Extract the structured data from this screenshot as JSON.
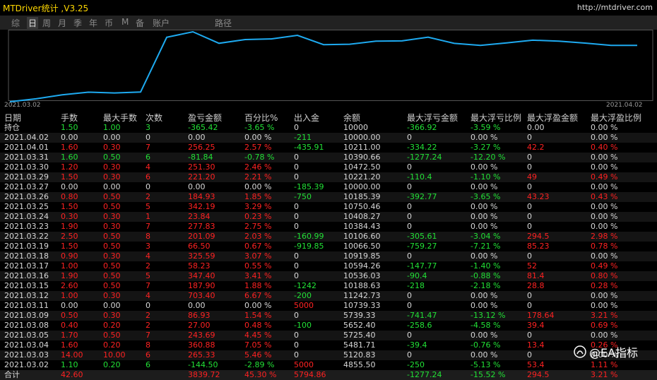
{
  "app": {
    "title": "MTDriver统计 ,V3.25",
    "url": "http://mtdriver.com"
  },
  "tabs": [
    {
      "label": "综",
      "active": false
    },
    {
      "label": "日",
      "active": true
    },
    {
      "label": "周",
      "active": false
    },
    {
      "label": "月",
      "active": false
    },
    {
      "label": "季",
      "active": false
    },
    {
      "label": "年",
      "active": false
    },
    {
      "label": "币",
      "active": false
    },
    {
      "label": "M",
      "active": false
    },
    {
      "label": "备",
      "active": false
    },
    {
      "label": "账户",
      "active": false
    },
    {
      "label": "路径",
      "active": false
    }
  ],
  "chart": {
    "start_label": "2021.03.02",
    "end_label": "2021.04.02",
    "line_color": "#1eaaf0",
    "series": [
      4855.5,
      5120.83,
      5481.71,
      5725.4,
      5652.4,
      5739.33,
      10739.33,
      11242.73,
      10188.63,
      10536.03,
      10594.26,
      10919.85,
      10066.5,
      10106.6,
      10384.43,
      10408.27,
      10750.46,
      10185.39,
      10000.0,
      10221.2,
      10472.5,
      10390.66,
      10211.0,
      10000.0,
      10000.0
    ]
  },
  "colors": {
    "green": "#22e036",
    "red": "#ff2222",
    "white": "#d8d8d8"
  },
  "columns": [
    "日期",
    "手数",
    "最大手数",
    "次数",
    "盈亏金额",
    "百分比%",
    "出入金",
    "余额",
    "最大浮亏金额",
    "最大浮亏比例",
    "最大浮盈金额",
    "最大浮盈比例"
  ],
  "rows": [
    {
      "date": "持仓",
      "lots": "1.50",
      "maxlots": "1.00",
      "count": "3",
      "pnl": "-365.42",
      "pct": "-3.65 %",
      "dep": "0",
      "bal": "10000",
      "mfl": "-366.92",
      "mflp": "-3.59 %",
      "mfp": "0.00",
      "mfpp": "0.00 %",
      "color": "green"
    },
    {
      "date": "2021.04.02",
      "lots": "0.00",
      "maxlots": "0.00",
      "count": "0",
      "pnl": "0.00",
      "pct": "0.00 %",
      "dep": "-211",
      "bal": "10000.00",
      "mfl": "0",
      "mflp": "0.00 %",
      "mfp": "0",
      "mfpp": "0.00 %",
      "color": "white"
    },
    {
      "date": "2021.04.01",
      "lots": "1.60",
      "maxlots": "0.30",
      "count": "7",
      "pnl": "256.25",
      "pct": "2.57 %",
      "dep": "-435.91",
      "bal": "10211.00",
      "mfl": "-334.22",
      "mflp": "-3.27 %",
      "mfp": "42.2",
      "mfpp": "0.40 %",
      "color": "red"
    },
    {
      "date": "2021.03.31",
      "lots": "1.60",
      "maxlots": "0.50",
      "count": "6",
      "pnl": "-81.84",
      "pct": "-0.78 %",
      "dep": "0",
      "bal": "10390.66",
      "mfl": "-1277.24",
      "mflp": "-12.20 %",
      "mfp": "0",
      "mfpp": "0.00 %",
      "color": "green"
    },
    {
      "date": "2021.03.30",
      "lots": "1.20",
      "maxlots": "0.30",
      "count": "4",
      "pnl": "251.30",
      "pct": "2.46 %",
      "dep": "0",
      "bal": "10472.50",
      "mfl": "0",
      "mflp": "0.00 %",
      "mfp": "0",
      "mfpp": "0.00 %",
      "color": "red"
    },
    {
      "date": "2021.03.29",
      "lots": "1.50",
      "maxlots": "0.30",
      "count": "6",
      "pnl": "221.20",
      "pct": "2.21 %",
      "dep": "0",
      "bal": "10221.20",
      "mfl": "-110.4",
      "mflp": "-1.10 %",
      "mfp": "49",
      "mfpp": "0.49 %",
      "color": "red"
    },
    {
      "date": "2021.03.27",
      "lots": "0.00",
      "maxlots": "0.00",
      "count": "0",
      "pnl": "0.00",
      "pct": "0.00 %",
      "dep": "-185.39",
      "bal": "10000.00",
      "mfl": "0",
      "mflp": "0.00 %",
      "mfp": "0",
      "mfpp": "0.00 %",
      "color": "white"
    },
    {
      "date": "2021.03.26",
      "lots": "0.80",
      "maxlots": "0.50",
      "count": "2",
      "pnl": "184.93",
      "pct": "1.85 %",
      "dep": "-750",
      "bal": "10185.39",
      "mfl": "-392.77",
      "mflp": "-3.65 %",
      "mfp": "43.23",
      "mfpp": "0.43 %",
      "color": "red"
    },
    {
      "date": "2021.03.25",
      "lots": "1.50",
      "maxlots": "0.50",
      "count": "5",
      "pnl": "342.19",
      "pct": "3.29 %",
      "dep": "0",
      "bal": "10750.46",
      "mfl": "0",
      "mflp": "0.00 %",
      "mfp": "0",
      "mfpp": "0.00 %",
      "color": "red"
    },
    {
      "date": "2021.03.24",
      "lots": "0.30",
      "maxlots": "0.30",
      "count": "1",
      "pnl": "23.84",
      "pct": "0.23 %",
      "dep": "0",
      "bal": "10408.27",
      "mfl": "0",
      "mflp": "0.00 %",
      "mfp": "0",
      "mfpp": "0.00 %",
      "color": "red"
    },
    {
      "date": "2021.03.23",
      "lots": "1.90",
      "maxlots": "0.30",
      "count": "7",
      "pnl": "277.83",
      "pct": "2.75 %",
      "dep": "0",
      "bal": "10384.43",
      "mfl": "0",
      "mflp": "0.00 %",
      "mfp": "0",
      "mfpp": "0.00 %",
      "color": "red"
    },
    {
      "date": "2021.03.22",
      "lots": "2.50",
      "maxlots": "0.50",
      "count": "8",
      "pnl": "201.09",
      "pct": "2.03 %",
      "dep": "-160.99",
      "bal": "10106.60",
      "mfl": "-305.61",
      "mflp": "-3.04 %",
      "mfp": "294.5",
      "mfpp": "2.98 %",
      "color": "red"
    },
    {
      "date": "2021.03.19",
      "lots": "1.50",
      "maxlots": "0.50",
      "count": "3",
      "pnl": "66.50",
      "pct": "0.67 %",
      "dep": "-919.85",
      "bal": "10066.50",
      "mfl": "-759.27",
      "mflp": "-7.21 %",
      "mfp": "85.23",
      "mfpp": "0.78 %",
      "color": "red"
    },
    {
      "date": "2021.03.18",
      "lots": "0.90",
      "maxlots": "0.30",
      "count": "4",
      "pnl": "325.59",
      "pct": "3.07 %",
      "dep": "0",
      "bal": "10919.85",
      "mfl": "0",
      "mflp": "0.00 %",
      "mfp": "0",
      "mfpp": "0.00 %",
      "color": "red"
    },
    {
      "date": "2021.03.17",
      "lots": "1.00",
      "maxlots": "0.50",
      "count": "2",
      "pnl": "58.23",
      "pct": "0.55 %",
      "dep": "0",
      "bal": "10594.26",
      "mfl": "-147.77",
      "mflp": "-1.40 %",
      "mfp": "52",
      "mfpp": "0.49 %",
      "color": "red"
    },
    {
      "date": "2021.03.16",
      "lots": "1.90",
      "maxlots": "0.50",
      "count": "5",
      "pnl": "347.40",
      "pct": "3.41 %",
      "dep": "0",
      "bal": "10536.03",
      "mfl": "-90.4",
      "mflp": "-0.88 %",
      "mfp": "81.4",
      "mfpp": "0.80 %",
      "color": "red"
    },
    {
      "date": "2021.03.15",
      "lots": "2.60",
      "maxlots": "0.50",
      "count": "7",
      "pnl": "187.90",
      "pct": "1.88 %",
      "dep": "-1242",
      "bal": "10188.63",
      "mfl": "-218",
      "mflp": "-2.18 %",
      "mfp": "28.8",
      "mfpp": "0.28 %",
      "color": "red"
    },
    {
      "date": "2021.03.12",
      "lots": "1.00",
      "maxlots": "0.30",
      "count": "4",
      "pnl": "703.40",
      "pct": "6.67 %",
      "dep": "-200",
      "bal": "11242.73",
      "mfl": "0",
      "mflp": "0.00 %",
      "mfp": "0",
      "mfpp": "0.00 %",
      "color": "red"
    },
    {
      "date": "2021.03.11",
      "lots": "0.00",
      "maxlots": "0.00",
      "count": "0",
      "pnl": "0.00",
      "pct": "0.00 %",
      "dep": "5000",
      "bal": "10739.33",
      "mfl": "0",
      "mflp": "0.00 %",
      "mfp": "0",
      "mfpp": "0.00 %",
      "color": "white"
    },
    {
      "date": "2021.03.09",
      "lots": "0.50",
      "maxlots": "0.30",
      "count": "2",
      "pnl": "86.93",
      "pct": "1.54 %",
      "dep": "0",
      "bal": "5739.33",
      "mfl": "-741.47",
      "mflp": "-13.12 %",
      "mfp": "178.64",
      "mfpp": "3.21 %",
      "color": "red"
    },
    {
      "date": "2021.03.08",
      "lots": "0.40",
      "maxlots": "0.20",
      "count": "2",
      "pnl": "27.00",
      "pct": "0.48 %",
      "dep": "-100",
      "bal": "5652.40",
      "mfl": "-258.6",
      "mflp": "-4.58 %",
      "mfp": "39.4",
      "mfpp": "0.69 %",
      "color": "red"
    },
    {
      "date": "2021.03.05",
      "lots": "1.70",
      "maxlots": "0.50",
      "count": "7",
      "pnl": "243.69",
      "pct": "4.45 %",
      "dep": "0",
      "bal": "5725.40",
      "mfl": "0",
      "mflp": "0.00 %",
      "mfp": "0",
      "mfpp": "0.00 %",
      "color": "red"
    },
    {
      "date": "2021.03.04",
      "lots": "1.60",
      "maxlots": "0.20",
      "count": "8",
      "pnl": "360.88",
      "pct": "7.05 %",
      "dep": "0",
      "bal": "5481.71",
      "mfl": "-39.4",
      "mflp": "-0.76 %",
      "mfp": "13.4",
      "mfpp": "0.26 %",
      "color": "red"
    },
    {
      "date": "2021.03.03",
      "lots": "14.00",
      "maxlots": "10.00",
      "count": "6",
      "pnl": "265.33",
      "pct": "5.46 %",
      "dep": "0",
      "bal": "5120.83",
      "mfl": "0",
      "mflp": "0.00 %",
      "mfp": "0",
      "mfpp": "0.00 %",
      "color": "red"
    },
    {
      "date": "2021.03.02",
      "lots": "1.10",
      "maxlots": "0.20",
      "count": "6",
      "pnl": "-144.50",
      "pct": "-2.89 %",
      "dep": "5000",
      "bal": "4855.50",
      "mfl": "-250",
      "mflp": "-5.13 %",
      "mfp": "53.4",
      "mfpp": "1.11 %",
      "color": "green"
    }
  ],
  "totals": {
    "date": "合计",
    "lots": "42.60",
    "maxlots": "",
    "count": "",
    "pnl": "3839.72",
    "pct": "45.30 %",
    "dep": "5794.86",
    "bal": "",
    "mfl": "-1277.24",
    "mflp": "-15.52 %",
    "mfp": "294.5",
    "mfpp": "3.21 %",
    "color": "red"
  },
  "watermark": {
    "text": "@EA指标"
  }
}
